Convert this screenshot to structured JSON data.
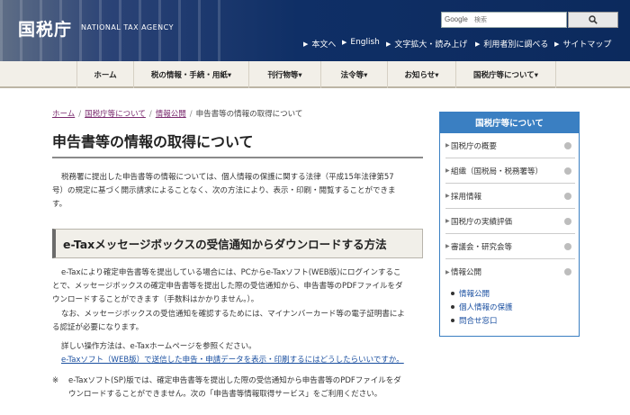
{
  "header": {
    "logo_ja": "国税庁",
    "logo_en": "NATIONAL TAX AGENCY",
    "search_brand": "Google",
    "search_placeholder": "検索",
    "util_links": [
      "本文へ",
      "English",
      "文字拡大・読み上げ",
      "利用者別に調べる",
      "サイトマップ"
    ]
  },
  "gnav": [
    "ホーム",
    "税の情報・手続・用紙▾",
    "刊行物等▾",
    "法令等▾",
    "お知らせ▾",
    "国税庁等について▾"
  ],
  "breadcrumb": {
    "items": [
      "ホーム",
      "国税庁等について",
      "情報公開"
    ],
    "current": "申告書等の情報の取得について",
    "sep": "/"
  },
  "main": {
    "title": "申告書等の情報の取得について",
    "intro_1": "税務署に提出した申告書等の情報については、個人情報の保護に関する法律（平成15年法律第57",
    "intro_2": "号）の規定に基づく開示請求によることなく、次の方法により、表示・印刷・閲覧することができま",
    "intro_3": "す。",
    "h2": "e-Taxメッセージボックスの受信通知からダウンロードする方法",
    "p1_1": "e-Taxにより確定申告書等を提出している場合には、PCからe-Taxソフト(WEB版)にログインするこ",
    "p1_2": "とで、メッセージボックスの確定申告書等を提出した際の受信通知から、申告書等のPDFファイルをダ",
    "p1_3": "ウンロードすることができます（手数料はかかりません。）。",
    "p2_1": "なお、メッセージボックスの受信通知を確認するためには、マイナンバーカード等の電子証明書によ",
    "p2_2": "る認証が必要になります。",
    "p3": "詳しい操作方法は、e-Taxホームページを参照ください。",
    "p3_link": "e-Taxソフト（WEB版）で送信した申告・申請データを表示・印刷するにはどうしたらいいですか。",
    "note_mark": "※",
    "note_1": "e-Taxソフト(SP)版では、確定申告書等を提出した際の受信通知から申告書等のPDFファイルをダ",
    "note_2": "ウンロードすることができません。次の「申告書等情報取得サービス」をご利用ください。"
  },
  "sidebar": {
    "heading": "国税庁等について",
    "items": [
      "国税庁の概要",
      "組織（国税局・税務署等）",
      "採用情報",
      "国税庁の実績評価",
      "審議会・研究会等",
      "情報公開"
    ],
    "sub_items": [
      "情報公開",
      "個人情報の保護",
      "問合せ窓口"
    ]
  }
}
